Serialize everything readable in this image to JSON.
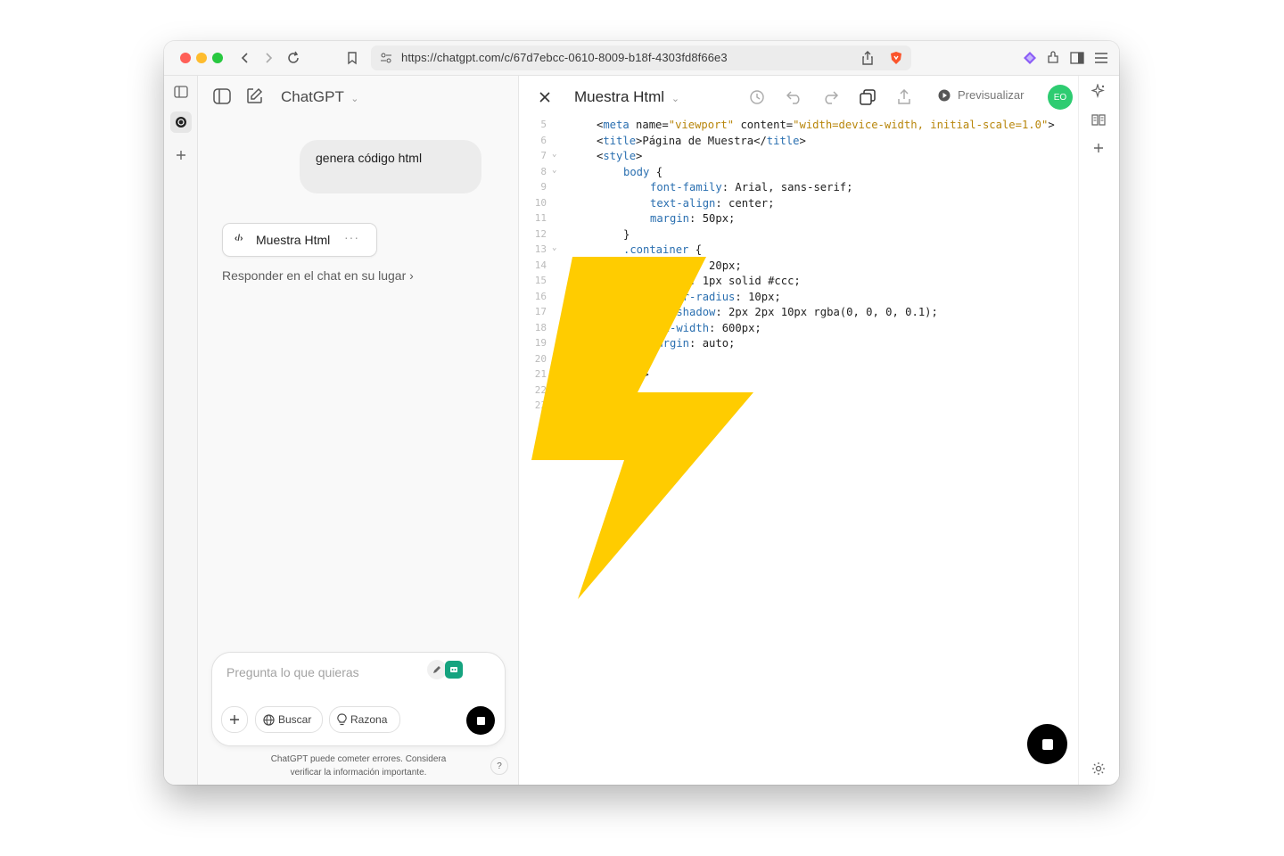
{
  "browser": {
    "url": "https://chatgpt.com/c/67d7ebcc-0610-8009-b18f-4303fd8f66e3"
  },
  "chat": {
    "app_title": "ChatGPT",
    "user_message": "genera código html",
    "artifact_card_label": "Muestra Html",
    "artifact_card_code_glyph": "‹/›",
    "artifact_card_more": "···",
    "respond_link": "Responder en el chat en su lugar ›",
    "composer_placeholder": "Pregunta lo que quieras",
    "buscar_label": "Buscar",
    "razona_label": "Razona",
    "disclaimer_line1": "ChatGPT puede cometer errores. Considera",
    "disclaimer_line2": "verificar la información importante.",
    "help_label": "?"
  },
  "editor": {
    "title": "Muestra Html",
    "preview_label": "Previsualizar",
    "avatar_initials": "EO",
    "lines": [
      {
        "n": "5",
        "fold": "",
        "text": "<meta name=\"viewport\" content=\"width=device-width, initial-scale=1.0\">",
        "indent": 0
      },
      {
        "n": "6",
        "fold": "",
        "text": "<title>Página de Muestra</title>",
        "indent": 0
      },
      {
        "n": "7",
        "fold": "⌄",
        "text": "<style>",
        "indent": 0
      },
      {
        "n": "8",
        "fold": "⌄",
        "text": "body {",
        "indent": 1
      },
      {
        "n": "9",
        "fold": "",
        "text": "font-family: Arial, sans-serif;",
        "indent": 2
      },
      {
        "n": "10",
        "fold": "",
        "text": "text-align: center;",
        "indent": 2
      },
      {
        "n": "11",
        "fold": "",
        "text": "margin: 50px;",
        "indent": 2
      },
      {
        "n": "12",
        "fold": "",
        "text": "}",
        "indent": 1
      },
      {
        "n": "13",
        "fold": "⌄",
        "text": ".container {",
        "indent": 1
      },
      {
        "n": "14",
        "fold": "",
        "text": "padding: 20px;",
        "indent": 2
      },
      {
        "n": "15",
        "fold": "",
        "text": "border: 1px solid #ccc;",
        "indent": 2
      },
      {
        "n": "16",
        "fold": "",
        "text": "border-radius: 10px;",
        "indent": 2
      },
      {
        "n": "17",
        "fold": "",
        "text": "box-shadow: 2px 2px 10px rgba(0, 0, 0, 0.1);",
        "indent": 2
      },
      {
        "n": "18",
        "fold": "",
        "text": "max-width: 600px;",
        "indent": 2
      },
      {
        "n": "19",
        "fold": "",
        "text": "margin: auto;",
        "indent": 2
      },
      {
        "n": "20",
        "fold": "",
        "text": "}",
        "indent": 1
      },
      {
        "n": "21",
        "fold": "",
        "text": "</style>",
        "indent": 0
      },
      {
        "n": "22",
        "fold": "",
        "text": "",
        "indent": 0
      },
      {
        "n": "23",
        "fold": "",
        "text": "",
        "indent": 0
      }
    ]
  },
  "colors": {
    "avatar": "#2ecc71",
    "bolt": "#ffcc00",
    "code_keyword": "#2a6fb0",
    "code_string": "#b8860b"
  },
  "icons": {
    "bolt": "lightning-bolt-overlay"
  }
}
